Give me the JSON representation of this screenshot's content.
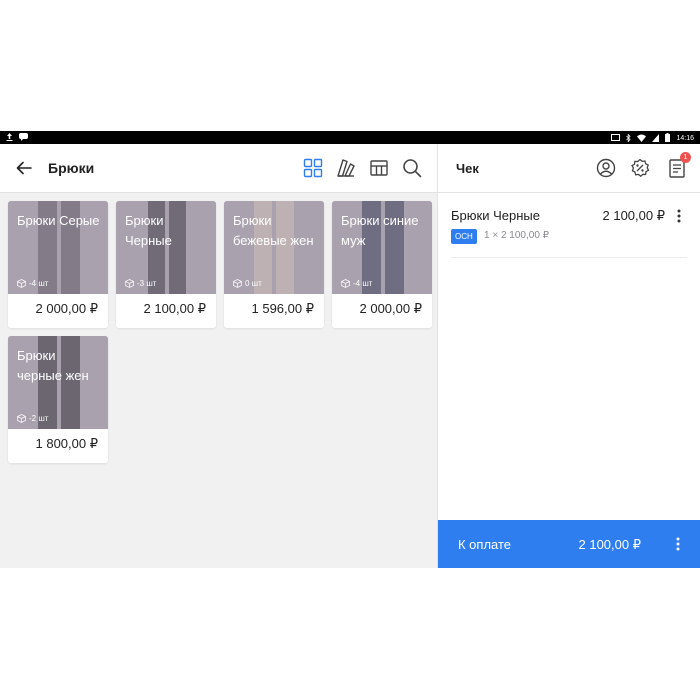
{
  "statusbar": {
    "time": "14:16"
  },
  "header": {
    "title": "Брюки"
  },
  "products": [
    {
      "name": "Брюки Серые",
      "stock": "-4 шт",
      "price": "2 000,00 ₽",
      "img_color": "#55505a"
    },
    {
      "name": "Брюки Черные",
      "stock": "-3 шт",
      "price": "2 100,00 ₽",
      "img_color": "#2b2a33"
    },
    {
      "name": "Брюки бежевые жен",
      "stock": "0 шт",
      "price": "1 596,00 ₽",
      "img_color": "#d6c6b9"
    },
    {
      "name": "Брюки синие муж",
      "stock": "-4 шт",
      "price": "2 000,00 ₽",
      "img_color": "#263049"
    },
    {
      "name": "Брюки черные жен",
      "stock": "-2 шт",
      "price": "1 800,00 ₽",
      "img_color": "#1f1f24"
    }
  ],
  "receipt": {
    "title": "Чек",
    "badge_count": "1",
    "items": [
      {
        "name": "Брюки Черные",
        "price": "2 100,00 ₽",
        "tag": "ОСН",
        "qty": "1 × 2 100,00 ₽"
      }
    ],
    "pay_label": "К оплате",
    "pay_amount": "2 100,00 ₽"
  },
  "colors": {
    "accent": "#2f7ef0",
    "badge": "#ef5350"
  }
}
